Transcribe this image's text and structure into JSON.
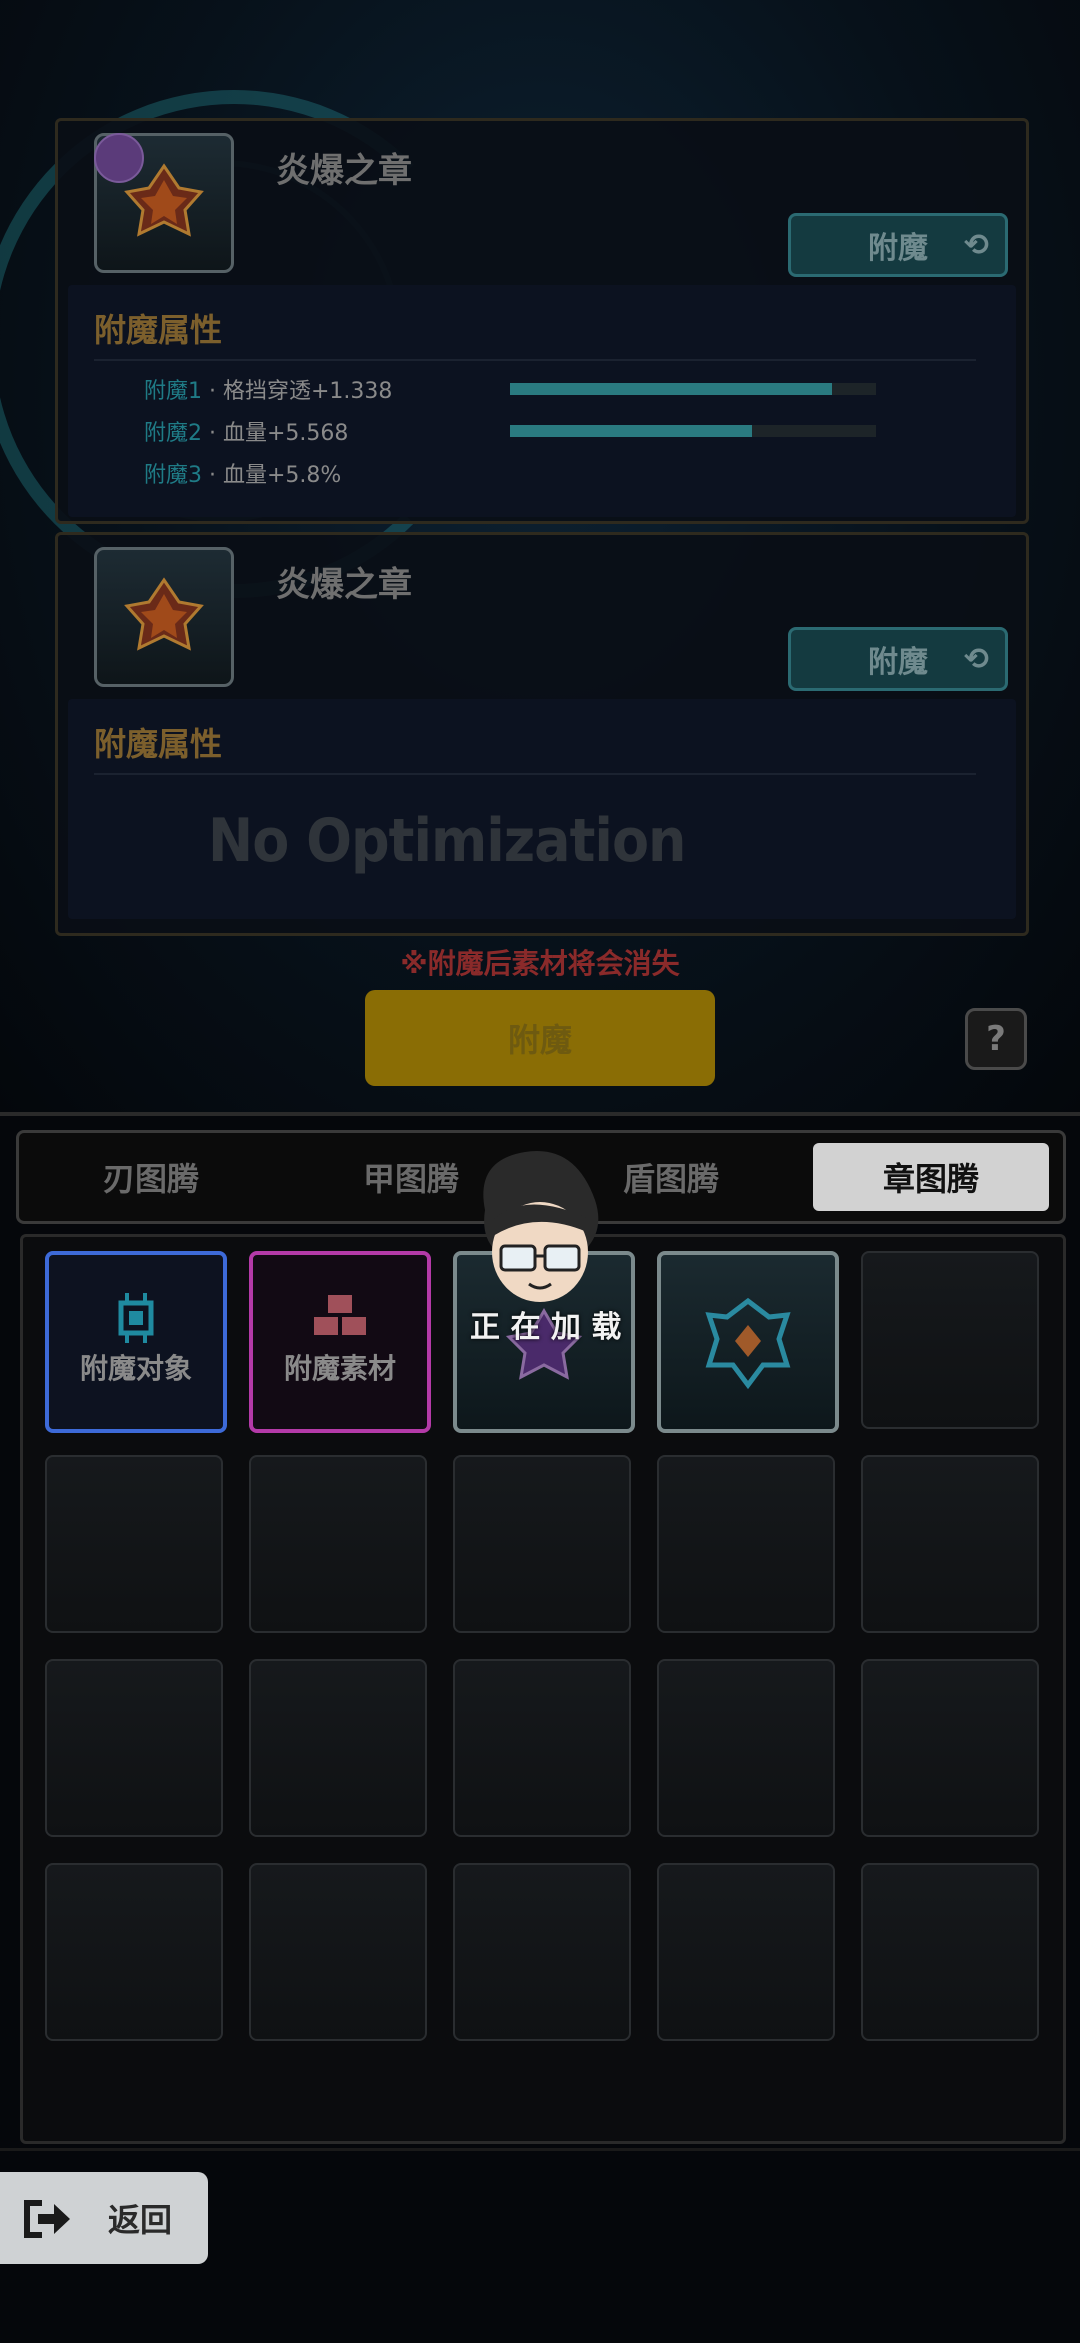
{
  "cards": [
    {
      "item_name": "炎爆之章",
      "enchant_button": "附魔",
      "attr_title": "附魔属性",
      "attributes": [
        {
          "key": "附魔1",
          "sep": "·",
          "text": "格挡穿透+1.338",
          "level": 0.88
        },
        {
          "key": "附魔2",
          "sep": "·",
          "text": "血量+5.568",
          "level": 0.66
        },
        {
          "key": "附魔3",
          "sep": "·",
          "text": "血量+5.8%"
        }
      ]
    },
    {
      "item_name": "炎爆之章",
      "enchant_button": "附魔",
      "attr_title": "附魔属性",
      "empty_text": "No Optimization"
    }
  ],
  "warning": "※附魔后素材将会消失",
  "main_button": "附魔",
  "help": "?",
  "tabs": [
    "刃图腾",
    "甲图腾",
    "盾图腾",
    "章图腾"
  ],
  "active_tab": 3,
  "slots": {
    "target_label": "附魔对象",
    "material_label": "附魔素材"
  },
  "loading_text": "正 在 加 载",
  "back_button": "返回",
  "colors": {
    "accent_teal": "#2a7a80",
    "gold": "#8a6d05",
    "warning_red": "#8a2a2a",
    "select_blue": "#3d6ad8",
    "select_pink": "#b43aa8"
  }
}
